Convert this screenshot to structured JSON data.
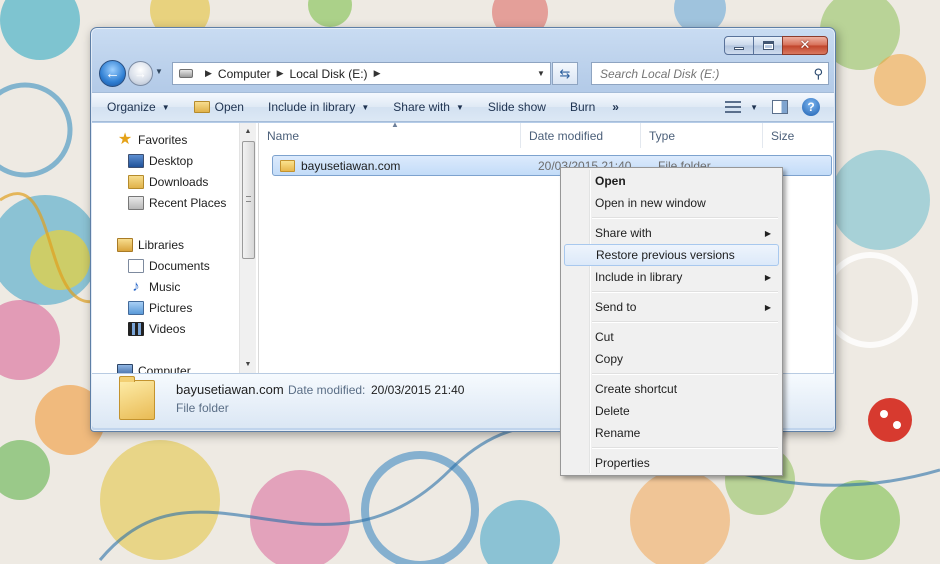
{
  "window": {
    "caption_buttons": {
      "minimize": "–",
      "maximize": "□",
      "close": "✕"
    }
  },
  "nav": {
    "breadcrumb": [
      "Computer",
      "Local Disk (E:)"
    ],
    "search_placeholder": "Search Local Disk (E:)"
  },
  "toolbar": {
    "organize": "Organize",
    "open": "Open",
    "include_in_library": "Include in library",
    "share_with": "Share with",
    "slide_show": "Slide show",
    "burn": "Burn",
    "more": "»"
  },
  "navpane": {
    "favorites": {
      "label": "Favorites",
      "items": [
        "Desktop",
        "Downloads",
        "Recent Places"
      ]
    },
    "libraries": {
      "label": "Libraries",
      "items": [
        "Documents",
        "Music",
        "Pictures",
        "Videos"
      ]
    },
    "computer": "Computer"
  },
  "filelist": {
    "columns": [
      "Name",
      "Date modified",
      "Type",
      "Size"
    ],
    "rows": [
      {
        "name": "bayusetiawan.com",
        "date_modified": "20/03/2015 21:40",
        "type": "File folder",
        "size": ""
      }
    ]
  },
  "details": {
    "name": "bayusetiawan.com",
    "date_label": "Date modified:",
    "date_value": "20/03/2015 21:40",
    "type": "File folder"
  },
  "context_menu": {
    "items": [
      {
        "label": "Open",
        "bold": true
      },
      {
        "label": "Open in new window"
      },
      {
        "label": "Share with",
        "submenu": true
      },
      {
        "label": "Restore previous versions",
        "highlighted": true
      },
      {
        "label": "Include in library",
        "submenu": true
      },
      {
        "label": "Send to",
        "submenu": true
      },
      {
        "label": "Cut"
      },
      {
        "label": "Copy"
      },
      {
        "label": "Create shortcut"
      },
      {
        "label": "Delete"
      },
      {
        "label": "Rename"
      },
      {
        "label": "Properties"
      }
    ]
  }
}
